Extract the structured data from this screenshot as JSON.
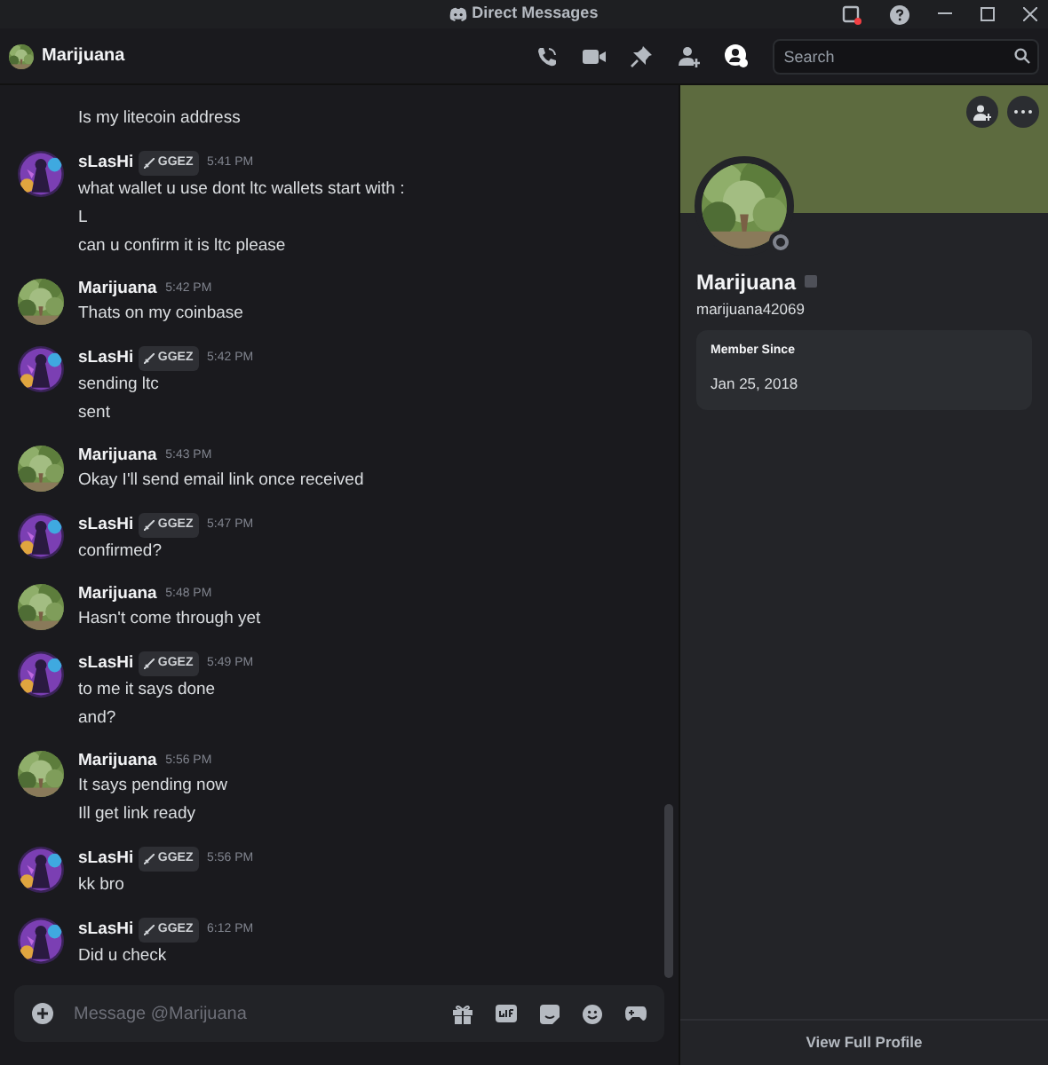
{
  "window": {
    "title": "Direct Messages"
  },
  "header": {
    "title": "Marijuana",
    "search": {
      "placeholder": "Search"
    },
    "profile_panel_open": true
  },
  "messages": [
    {
      "kind": "continuation",
      "lines": [
        "Is my litecoin address"
      ]
    },
    {
      "kind": "group",
      "author": "sLasHi",
      "badge": "GGEZ",
      "time": "5:41 PM",
      "lines": [
        "what wallet u use dont ltc wallets start with :",
        "L",
        "can u confirm it is ltc please"
      ]
    },
    {
      "kind": "group",
      "author": "Marijuana",
      "time": "5:42 PM",
      "lines": [
        "Thats on my coinbase"
      ]
    },
    {
      "kind": "group",
      "author": "sLasHi",
      "badge": "GGEZ",
      "time": "5:42 PM",
      "lines": [
        "sending ltc",
        "sent"
      ]
    },
    {
      "kind": "group",
      "author": "Marijuana",
      "time": "5:43 PM",
      "lines": [
        "Okay I'll send email link once received"
      ]
    },
    {
      "kind": "group",
      "author": "sLasHi",
      "badge": "GGEZ",
      "time": "5:47 PM",
      "lines": [
        "confirmed?"
      ]
    },
    {
      "kind": "group",
      "author": "Marijuana",
      "time": "5:48 PM",
      "lines": [
        "Hasn't come through yet"
      ]
    },
    {
      "kind": "group",
      "author": "sLasHi",
      "badge": "GGEZ",
      "time": "5:49 PM",
      "lines": [
        "to me it says done",
        "and?"
      ]
    },
    {
      "kind": "group",
      "author": "Marijuana",
      "time": "5:56 PM",
      "lines": [
        "It says pending now",
        "Ill get link ready"
      ]
    },
    {
      "kind": "group",
      "author": "sLasHi",
      "badge": "GGEZ",
      "time": "5:56 PM",
      "lines": [
        "kk bro"
      ]
    },
    {
      "kind": "group",
      "author": "sLasHi",
      "badge": "GGEZ",
      "time": "6:12 PM",
      "lines": [
        "Did u check"
      ]
    }
  ],
  "composer": {
    "placeholder": "Message @Marijuana"
  },
  "profile": {
    "name": "Marijuana",
    "username": "marijuana42069",
    "member_since_label": "Member Since",
    "member_since": "Jan 25, 2018",
    "footer_link": "View Full Profile"
  }
}
